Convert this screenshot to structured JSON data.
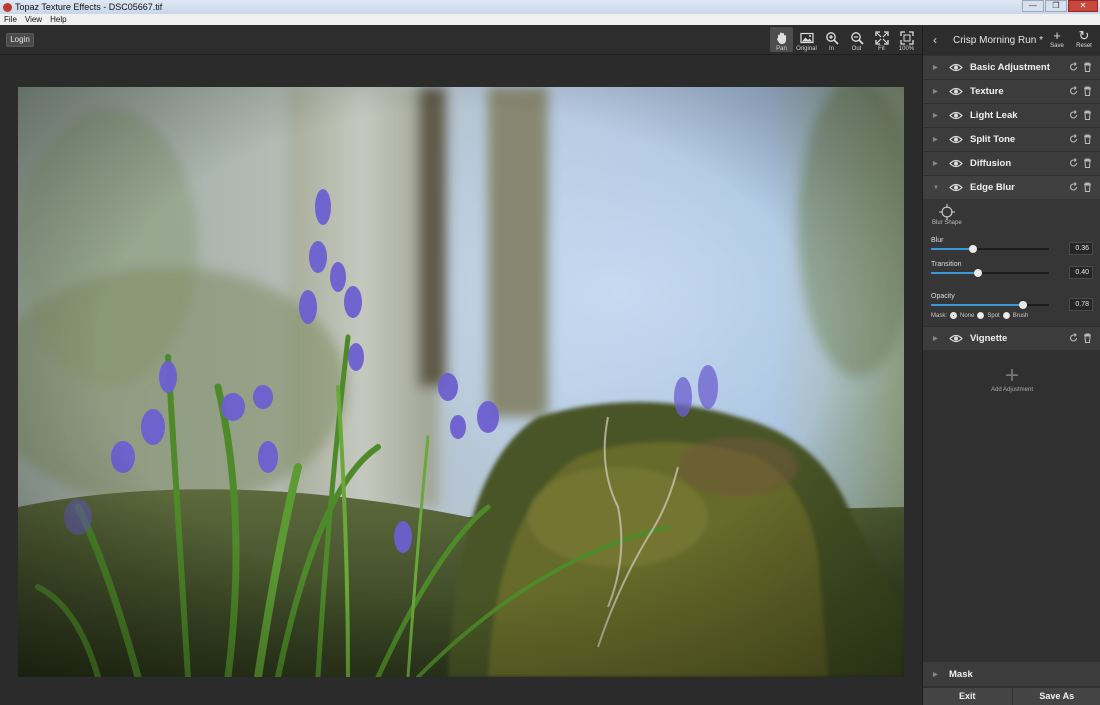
{
  "window": {
    "title": "Topaz Texture Effects - DSC05667.tif",
    "minimize": "—",
    "maximize": "❐",
    "close": "✕"
  },
  "menu": [
    "File",
    "View",
    "Help"
  ],
  "toolbar": {
    "login": "Login",
    "tools": [
      {
        "label": "Pan",
        "icon": "hand-icon",
        "active": true
      },
      {
        "label": "Original",
        "icon": "image-icon",
        "active": false
      },
      {
        "label": "In",
        "icon": "zoom-in-icon",
        "active": false
      },
      {
        "label": "Out",
        "icon": "zoom-out-icon",
        "active": false
      },
      {
        "label": "Fit",
        "icon": "fit-icon",
        "active": false
      },
      {
        "label": "100%",
        "icon": "actual-size-icon",
        "active": false
      }
    ]
  },
  "panel": {
    "preset_name": "Crisp Morning Run *",
    "save": "Save",
    "reset": "Reset",
    "adjustments": [
      {
        "label": "Basic Adjustment",
        "open": false
      },
      {
        "label": "Texture",
        "open": false
      },
      {
        "label": "Light Leak",
        "open": false
      },
      {
        "label": "Split Tone",
        "open": false
      },
      {
        "label": "Diffusion",
        "open": false
      },
      {
        "label": "Edge Blur",
        "open": true
      },
      {
        "label": "Vignette",
        "open": false
      }
    ],
    "edge_blur": {
      "blur_shape": "Blur Shape",
      "sliders": [
        {
          "label": "Blur",
          "value": "0.36",
          "fraction": 0.36
        },
        {
          "label": "Transition",
          "value": "0.40",
          "fraction": 0.4
        },
        {
          "label": "Opacity",
          "value": "0.78",
          "fraction": 0.78
        }
      ],
      "mask_label": "Mask:",
      "mask_options": [
        "None",
        "Spot",
        "Brush"
      ],
      "mask_selected": "None"
    },
    "add_adjustment": "Add Adjustment",
    "mask": "Mask",
    "exit": "Exit",
    "save_as": "Save As"
  },
  "colors": {
    "accent": "#3a9ad9",
    "panel_bg": "#303030",
    "row_bg": "#3c3c3c"
  }
}
